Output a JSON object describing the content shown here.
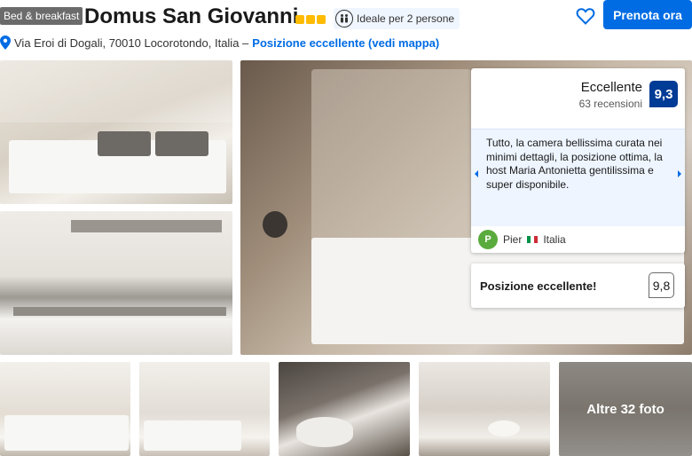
{
  "header": {
    "badge": "Bed & breakfast",
    "title": "Domus San Giovanni",
    "stars": 3,
    "ideal_label": "Ideale per 2 persone",
    "book_button": "Prenota ora"
  },
  "address": {
    "text": "Via Eroi di Dogali, 70010 Locorotondo, Italia –",
    "link": "Posizione eccellente (vedi mappa)"
  },
  "review_card": {
    "rating_word": "Eccellente",
    "review_count": "63 recensioni",
    "score": "9,3",
    "quote": "Tutto, la camera bellissima curata nei minimi dettagli, la posizione ottima, la host Maria Antonietta gentilissima e super disponibile.",
    "reviewer_initial": "P",
    "reviewer_name": "Pier",
    "reviewer_country": "Italia"
  },
  "location_card": {
    "label": "Posizione eccellente!",
    "score": "9,8"
  },
  "gallery": {
    "more_photos": "Altre 32 foto"
  },
  "colors": {
    "primary_blue": "#006ce4",
    "score_blue": "#003b95",
    "star_yellow": "#febb02",
    "avatar_green": "#5aab3d"
  },
  "icons": [
    "persons-icon",
    "heart-icon",
    "map-pin-icon",
    "chevron-left-icon",
    "chevron-right-icon",
    "italy-flag-icon"
  ]
}
